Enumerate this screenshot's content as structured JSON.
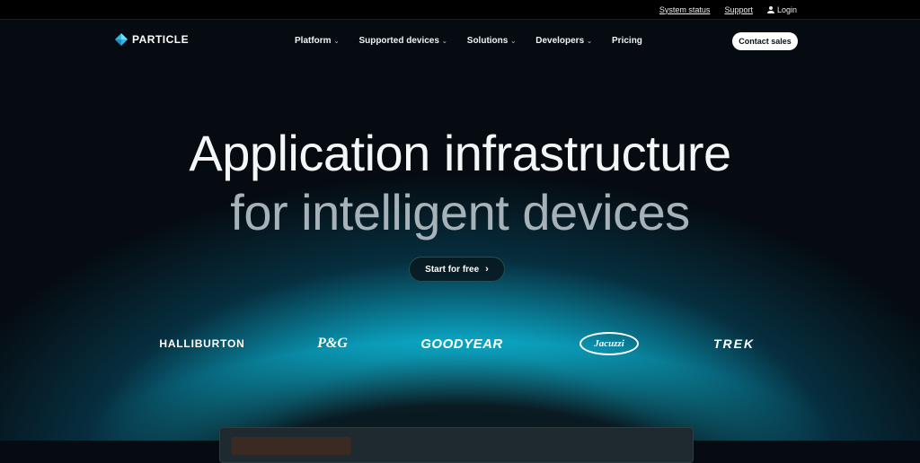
{
  "topbar": {
    "system_status": "System status",
    "support": "Support",
    "login": "Login"
  },
  "nav": {
    "brand": "PARTICLE",
    "items": [
      {
        "label": "Platform",
        "has_dropdown": true
      },
      {
        "label": "Supported devices",
        "has_dropdown": true
      },
      {
        "label": "Solutions",
        "has_dropdown": true
      },
      {
        "label": "Developers",
        "has_dropdown": true
      },
      {
        "label": "Pricing",
        "has_dropdown": false
      }
    ],
    "contact_label": "Contact sales"
  },
  "hero": {
    "line1": "Application infrastructure",
    "line2": "for intelligent devices",
    "cta_label": "Start for free",
    "cta_arrow": "›"
  },
  "logos": {
    "halliburton": "HALLIBURTON",
    "pg": "P&G",
    "goodyear": "GOODYEAR",
    "jacuzzi": "Jacuzzi",
    "trek": "TREK"
  },
  "colors": {
    "accent_glow": "#18d6ee",
    "background": "#050b10",
    "button_bg": "#ffffff"
  }
}
